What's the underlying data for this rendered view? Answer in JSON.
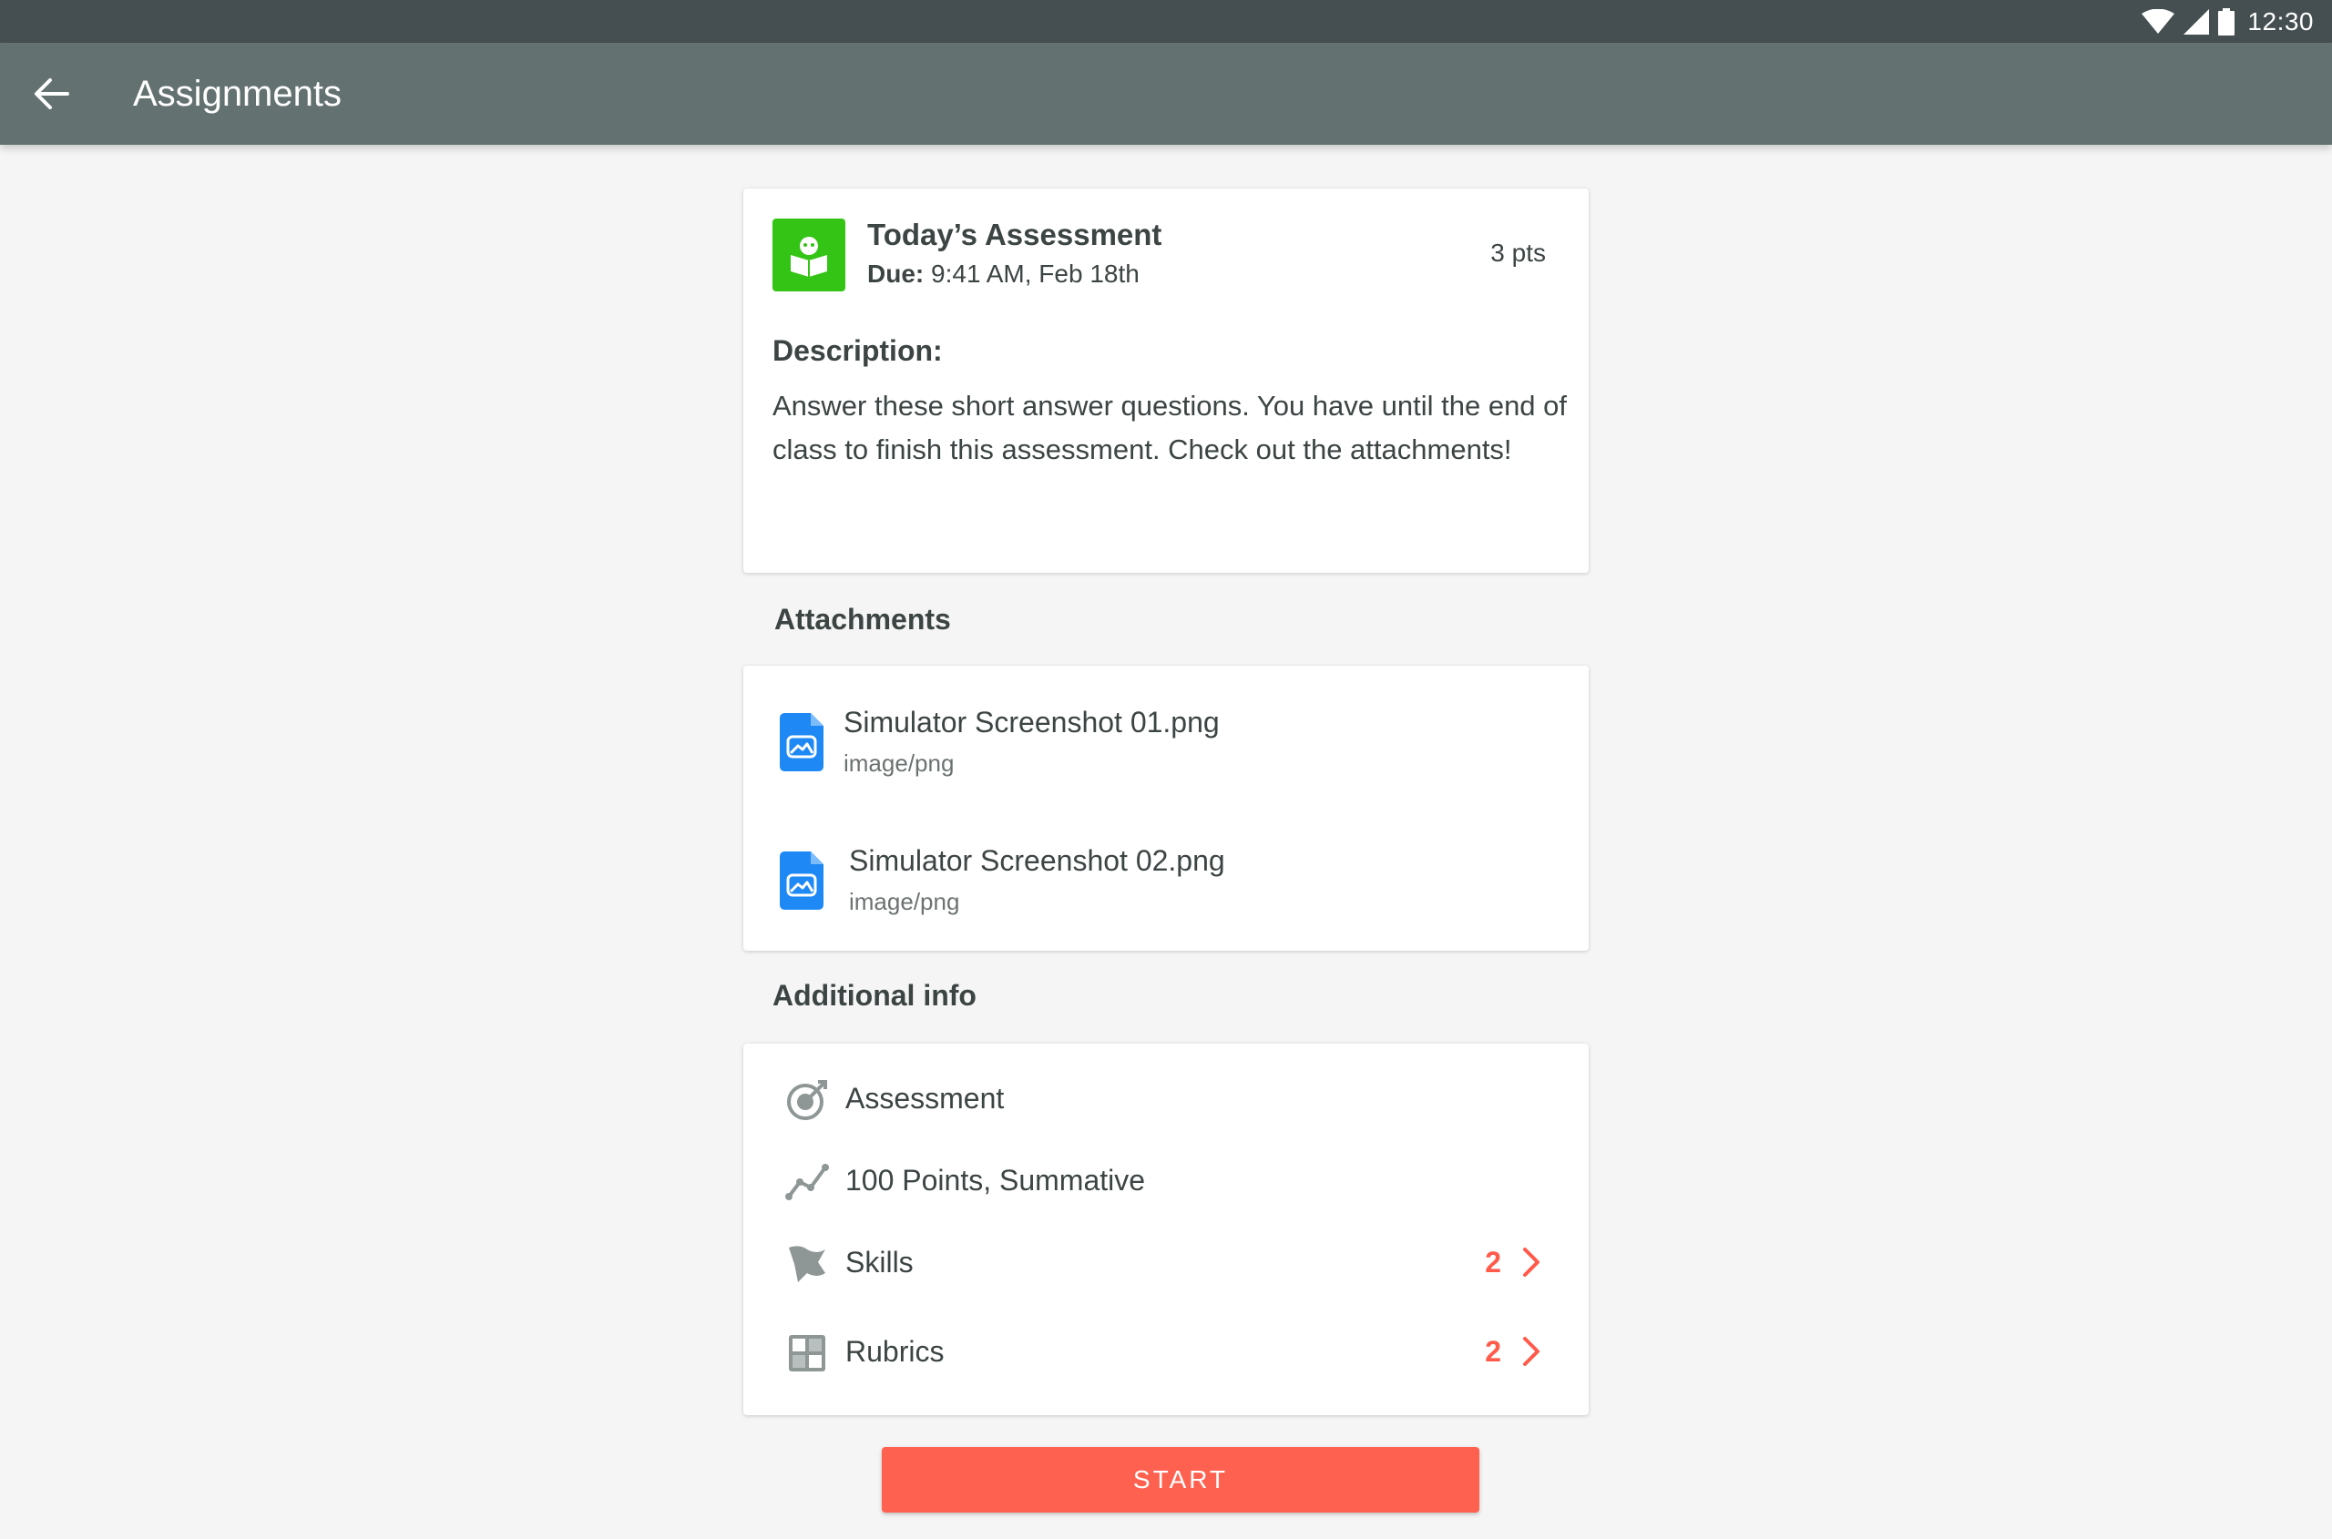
{
  "status_bar": {
    "time": "12:30",
    "icons": [
      "wifi-icon",
      "cell-signal-icon",
      "battery-icon"
    ]
  },
  "app_bar": {
    "title": "Assignments",
    "back_icon": "arrow-left-icon"
  },
  "assignment": {
    "icon": "reading-book-icon",
    "icon_color": "#34c415",
    "title": "Today’s Assessment",
    "due_label": "Due:",
    "due_value": "9:41 AM, Feb 18th",
    "points": "3 pts",
    "description_heading": "Description:",
    "description": "Answer these short answer questions. You have until the end of class to finish this assessment.  Check out the attachments!"
  },
  "attachments": {
    "heading": "Attachments",
    "items": [
      {
        "name": "Simulator Screenshot 01.png",
        "type": "image/png",
        "icon": "image-file-icon"
      },
      {
        "name": "Simulator Screenshot 02.png",
        "type": "image/png",
        "icon": "image-file-icon"
      }
    ]
  },
  "additional_info": {
    "heading": "Additional info",
    "rows": [
      {
        "label": "Assessment",
        "icon": "target-icon"
      },
      {
        "label": "100 Points, Summative",
        "icon": "trend-line-icon"
      },
      {
        "label": "Skills",
        "icon": "flag-icon",
        "count": "2"
      },
      {
        "label": "Rubrics",
        "icon": "grid-icon",
        "count": "2"
      }
    ]
  },
  "start_button": {
    "label": "START"
  },
  "colors": {
    "status_bar": "#454f52",
    "app_bar": "#637170",
    "accent": "#ff6150",
    "file_icon": "#1e88f5"
  }
}
